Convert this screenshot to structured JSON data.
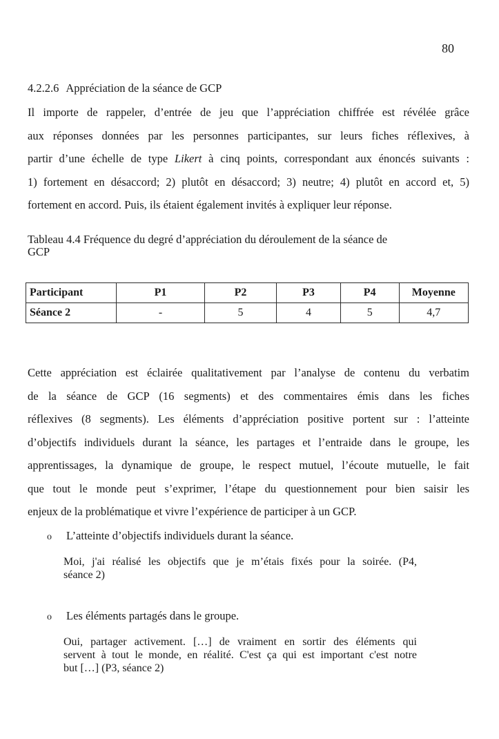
{
  "page": {
    "number": "80"
  },
  "section": {
    "number": "4.2.2.6",
    "title": "Appréciation de la séance de GCP"
  },
  "intro_paragraph": {
    "lines": [
      "Il importe de rappeler, d’entrée de jeu que l’appréciation chiffrée est révélée grâce",
      "aux réponses données par les personnes participantes, sur leurs fiches réflexives, à",
      "partir d’une échelle de type ",
      "1) fortement en désaccord; 2) plutôt en désaccord; 3) neutre; 4) plutôt en accord et, 5)",
      "fortement en accord. Puis, ils étaient également invités à expliquer leur réponse."
    ],
    "likert_word": "Likert",
    "line3_rest": " à cinq points, correspondant aux énoncés suivants :"
  },
  "table": {
    "caption_line1": "Tableau 4.4 Fréquence du degré d’appréciation du déroulement de la séance de",
    "caption_line2": "GCP",
    "headers": [
      "Participant",
      "P1",
      "P2",
      "P3",
      "P4",
      "Moyenne"
    ],
    "rows": [
      [
        "Séance 2",
        "-",
        "5",
        "4",
        "5",
        "4,7"
      ]
    ]
  },
  "analysis_paragraph": {
    "lines": [
      "Cette appréciation est éclairée qualitativement par l’analyse de contenu du verbatim",
      "de la séance de GCP (16 segments) et des commentaires émis dans les fiches",
      "réflexives (8 segments). Les éléments d’appréciation positive portent sur : l’atteinte",
      "d’objectifs individuels durant la séance, les partages et l’entraide dans le groupe, les",
      "apprentissages, la dynamique de groupe, le respect mutuel, l’écoute mutuelle, le fait",
      "que tout le monde peut s’exprimer, l’étape du questionnement pour bien saisir les",
      "enjeux de la problématique et vivre l’expérience de participer à un GCP."
    ]
  },
  "bullets": [
    {
      "marker": "o",
      "text": "L’atteinte d’objectifs individuels durant la séance.",
      "quote_lines": [
        "Moi, j'ai réalisé les objectifs que je m’étais fixés pour la soirée. (P4,",
        "séance 2)"
      ]
    },
    {
      "marker": "o",
      "text": "Les éléments partagés dans le groupe.",
      "quote_lines": [
        "Oui, partager activement. […] de vraiment en sortir des éléments qui",
        "servent à tout le monde, en réalité. C'est ça qui est important c'est notre",
        "but […] (P3, séance 2)"
      ]
    }
  ]
}
